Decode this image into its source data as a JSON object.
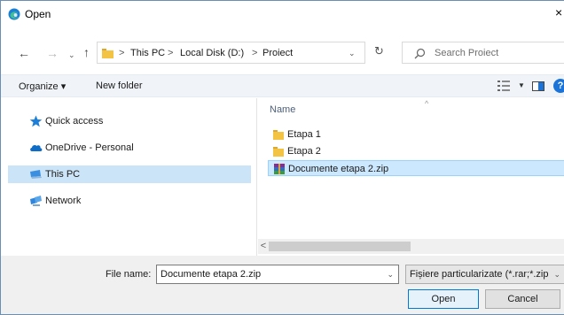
{
  "window": {
    "title": "Open",
    "close_glyph": "×"
  },
  "nav_buttons": {
    "back": "←",
    "forward": "→",
    "forward_dropdown": "⌄",
    "up": "↑"
  },
  "address": {
    "crumbs": [
      "This PC",
      "Local Disk (D:)",
      "Proiect"
    ],
    "separator": ">"
  },
  "search": {
    "placeholder": "Search Proiect"
  },
  "toolbar": {
    "organize": "Organize ▾",
    "new_folder": "New folder"
  },
  "nav_pane": {
    "items": [
      {
        "label": "Quick access",
        "icon": "star-icon"
      },
      {
        "label": "OneDrive - Personal",
        "icon": "cloud-icon"
      },
      {
        "label": "This PC",
        "icon": "computer-icon",
        "selected": true
      },
      {
        "label": "Network",
        "icon": "network-icon"
      }
    ]
  },
  "file_list": {
    "column_name": "Name",
    "items": [
      {
        "name": "Etapa 1",
        "type": "folder"
      },
      {
        "name": "Etapa 2",
        "type": "folder"
      },
      {
        "name": "Documente etapa 2.zip",
        "type": "archive",
        "selected": true
      }
    ]
  },
  "scrollbar": {
    "left_arrow": "<"
  },
  "footer": {
    "file_name_label": "File name:",
    "file_name_value": "Documente etapa 2.zip",
    "filter_value": "Fișiere particularizate (*.rar;*.zip",
    "open_label": "Open",
    "cancel_label": "Cancel"
  },
  "colors": {
    "accent": "#0078d7",
    "selection": "#cce8ff",
    "nav_selection": "#cce4f7",
    "folder": "#f3c443"
  }
}
